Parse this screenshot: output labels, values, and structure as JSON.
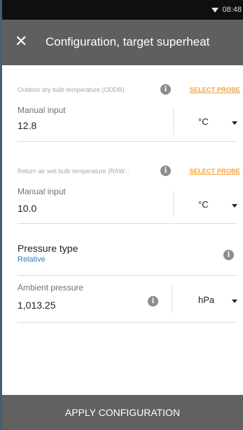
{
  "status_bar": {
    "time": "08:48",
    "wifi_icon": "wifi-icon"
  },
  "header": {
    "close_icon": "close-icon",
    "title": "Configuration, target superheat"
  },
  "fields": [
    {
      "section_label": "Outdoor dry bulb temperature (ODDB)",
      "select_probe": "SELECT PROBE",
      "label": "Manual input",
      "value": "12.8",
      "unit": "°C"
    },
    {
      "section_label": "Return air wet bulb temperature (RAW...",
      "select_probe": "SELECT PROBE",
      "label": "Manual input",
      "value": "10.0",
      "unit": "°C"
    }
  ],
  "pressure_type": {
    "title": "Pressure type",
    "value": "Relative"
  },
  "ambient_pressure": {
    "label": "Ambient pressure",
    "value": "1,013.25",
    "unit": "hPa"
  },
  "footer": {
    "button_label": "APPLY CONFIGURATION"
  },
  "colors": {
    "accent": "#f0a23c",
    "link": "#3a7fb8",
    "appbar": "#5f5f5f",
    "footer": "#616161"
  }
}
